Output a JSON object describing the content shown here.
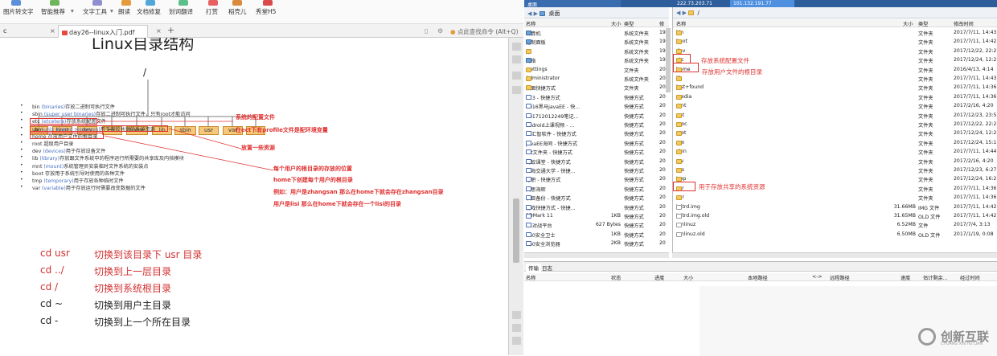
{
  "toolbar": {
    "items": [
      "图片转文字",
      "智能推荐",
      "文字工具",
      "朗读",
      "文档修复",
      "划词翻译",
      "打赏",
      "稻壳儿",
      "秀堂H5"
    ],
    "chevron": "▾"
  },
  "tabs": {
    "first": "c",
    "active": "day26--linux入门.pdf",
    "add": "+",
    "close": "×",
    "search_placeholder": "点此查找命令 (Alt+Q)"
  },
  "doc": {
    "title": "Linux目录结构",
    "root": "/",
    "boxes": [
      "bin",
      "boot",
      "dev",
      "etc",
      "home",
      "lib",
      "sbin",
      "usr",
      "var",
      "..."
    ],
    "bullets": [
      {
        "head": "bin",
        "blue": "(binaries)",
        "rest": "存放二进制可执行文件"
      },
      {
        "head": "sbin",
        "blue": "(super user binaries)",
        "rest": "存放二进制可执行文件，只有root才能访问"
      },
      {
        "head": "etc",
        "blue": "(etcetera)",
        "rest": "存放系统配置文件"
      },
      {
        "head": "usr",
        "blue": "(unix shared resources)",
        "rest": "用于存放共享的系统资源"
      },
      {
        "head": "home",
        "blue": "",
        "rest": "存放用户文件的根目录"
      },
      {
        "head": "root",
        "blue": "",
        "rest": "超级用户目录"
      },
      {
        "head": "dev",
        "blue": "(devices)",
        "rest": "用于存放设备文件"
      },
      {
        "head": "lib",
        "blue": "(library)",
        "rest": "存放跟文件系统中的程序运行所需要的共享库及内核模块"
      },
      {
        "head": "mnt",
        "blue": "(mount)",
        "rest": "系统管理员安装临时文件系统的安装点"
      },
      {
        "head": "boot",
        "blue": "",
        "rest": "存放用于系统引导时使用的各种文件"
      },
      {
        "head": "tmp",
        "blue": "(temporary)",
        "rest": "用于存放各种临时文件"
      },
      {
        "head": "var",
        "blue": "(variable)",
        "rest": "用于存放运行时需要改变数据的文件"
      }
    ],
    "notes": [
      "系统的配置文件",
      "在ect下有profile文件是配环境变量",
      "放置一些资源",
      "每个用户的根目录的存放的位置",
      "home下创建每个用户的根目录",
      "例如：用户是zhangsan 那么在home下就会存在zhangsan目录",
      "用户是lisi 那么在home下就会存在一个lisi的目录"
    ],
    "commands": [
      {
        "cmd": "cd usr",
        "desc": "切换到该目录下 usr 目录",
        "color": "#d23030"
      },
      {
        "cmd": "cd ../",
        "desc": "切换到上一层目录",
        "color": "#d23030"
      },
      {
        "cmd": "cd /",
        "desc": "切换到系统根目录",
        "color": "#d23030"
      },
      {
        "cmd": "cd ~",
        "desc": "切换到用户主目录",
        "color": "#222222"
      },
      {
        "cmd": "cd -",
        "desc": "切换到上一个所在目录",
        "color": "#222222"
      }
    ]
  },
  "ftp": {
    "window_tabs": [
      "桌面",
      "222.73.203.71",
      "101.132.191.77"
    ],
    "local_path": "桌面",
    "remote_path": "/",
    "local_cols": {
      "name": "名称",
      "size": "大小",
      "type": "类型",
      "mod": "修"
    },
    "remote_cols": {
      "name": "名称",
      "size": "大小",
      "type": "类型",
      "mod": "修改时间"
    },
    "local_rows": [
      {
        "name": "计算机",
        "size": "",
        "type": "系统文件夹",
        "mod": "19",
        "icon": "sys"
      },
      {
        "name": "控制面板",
        "size": "",
        "type": "系统文件夹",
        "mod": "19",
        "icon": "sys"
      },
      {
        "name": "库",
        "size": "",
        "type": "系统文件夹",
        "mod": "19",
        "icon": "fld"
      },
      {
        "name": "网络",
        "size": "",
        "type": "系统文件夹",
        "mod": "19",
        "icon": "sys"
      },
      {
        "name": ".settings",
        "size": "",
        "type": "文件夹",
        "mod": "20",
        "icon": "fld"
      },
      {
        "name": "Administrator",
        "size": "",
        "type": "系统文件夹",
        "mod": "20",
        "icon": "fld"
      },
      {
        "name": "桌面快捷方式",
        "size": "",
        "type": "文件夹",
        "mod": "20",
        "icon": "fld"
      },
      {
        "name": "123 - 快捷方式",
        "size": "",
        "type": "快捷方式",
        "mod": "20",
        "icon": "lnk"
      },
      {
        "name": "2016黑马javaEE - 快...",
        "size": "",
        "type": "快捷方式",
        "mod": "20",
        "icon": "lnk"
      },
      {
        "name": "201712012249笔记...",
        "size": "",
        "type": "快捷方式",
        "mod": "20",
        "icon": "lnk"
      },
      {
        "name": "android上课视频 - ...",
        "size": "",
        "type": "快捷方式",
        "mod": "20",
        "icon": "lnk"
      },
      {
        "name": "hz汇智软件 - 快捷方式",
        "size": "",
        "type": "快捷方式",
        "mod": "20",
        "icon": "lnk"
      },
      {
        "name": "JavaEE海同 - 快捷方式",
        "size": "",
        "type": "快捷方式",
        "mod": "20",
        "icon": "lnk"
      },
      {
        "name": "txt文件夹 - 快捷方式",
        "size": "",
        "type": "快捷方式",
        "mod": "20",
        "icon": "lnk"
      },
      {
        "name": "蚂蚁课堂 - 快捷方式",
        "size": "",
        "type": "快捷方式",
        "mod": "20",
        "icon": "lnk"
      },
      {
        "name": "上海交通大学 - 快捷...",
        "size": "",
        "type": "快捷方式",
        "mod": "20",
        "icon": "lnk"
      },
      {
        "name": "万职 - 快捷方式",
        "size": "",
        "type": "快捷方式",
        "mod": "20",
        "icon": "lnk"
      },
      {
        "name": "文思海辉",
        "size": "",
        "type": "快捷方式",
        "mod": "20",
        "icon": "lnk"
      },
      {
        "name": "项目备份 - 快捷方式",
        "size": "",
        "type": "快捷方式",
        "mod": "20",
        "icon": "lnk"
      },
      {
        "name": "游戏快捷方式 - 快捷...",
        "size": "",
        "type": "快捷方式",
        "mod": "20",
        "icon": "lnk"
      },
      {
        "name": "3DMark 11",
        "size": "1KB",
        "type": "快捷方式",
        "mod": "20",
        "icon": "lnk"
      },
      {
        "name": "11对战平台",
        "size": "627 Bytes",
        "type": "快捷方式",
        "mod": "20",
        "icon": "lnk"
      },
      {
        "name": "360安全卫士",
        "size": "1KB",
        "type": "快捷方式",
        "mod": "20",
        "icon": "lnk"
      },
      {
        "name": "360安全浏览器",
        "size": "2KB",
        "type": "快捷方式",
        "mod": "20",
        "icon": "lnk"
      }
    ],
    "remote_rows": [
      {
        "name": "bin",
        "size": "",
        "type": "文件夹",
        "mod": "2017/7/11, 14:43",
        "icon": "fld"
      },
      {
        "name": "boot",
        "size": "",
        "type": "文件夹",
        "mod": "2017/7/11, 14:42",
        "icon": "fld"
      },
      {
        "name": "dev",
        "size": "",
        "type": "文件夹",
        "mod": "2017/12/22, 22:27",
        "icon": "fld"
      },
      {
        "name": "etc",
        "size": "",
        "type": "文件夹",
        "mod": "2017/12/24, 12:20",
        "icon": "fld"
      },
      {
        "name": "home",
        "size": "",
        "type": "文件夹",
        "mod": "2016/4/13, 4:14",
        "icon": "fld"
      },
      {
        "name": "lib",
        "size": "",
        "type": "文件夹",
        "mod": "2017/7/11, 14:43",
        "icon": "fld"
      },
      {
        "name": "lost+found",
        "size": "",
        "type": "文件夹",
        "mod": "2017/7/11, 14:36",
        "icon": "fld"
      },
      {
        "name": "media",
        "size": "",
        "type": "文件夹",
        "mod": "2017/7/11, 14:36",
        "icon": "fld"
      },
      {
        "name": "mnt",
        "size": "",
        "type": "文件夹",
        "mod": "2017/2/16, 4:20",
        "icon": "fld"
      },
      {
        "name": "opt",
        "size": "",
        "type": "文件夹",
        "mod": "2017/12/23, 23:51",
        "icon": "fld"
      },
      {
        "name": "proc",
        "size": "",
        "type": "文件夹",
        "mod": "2017/12/22, 22:27",
        "icon": "fld"
      },
      {
        "name": "root",
        "size": "",
        "type": "文件夹",
        "mod": "2017/12/24, 12:20",
        "icon": "fld"
      },
      {
        "name": "run",
        "size": "",
        "type": "文件夹",
        "mod": "2017/12/24, 15:10",
        "icon": "fld"
      },
      {
        "name": "sbin",
        "size": "",
        "type": "文件夹",
        "mod": "2017/7/11, 14:44",
        "icon": "fld"
      },
      {
        "name": "srv",
        "size": "",
        "type": "文件夹",
        "mod": "2017/2/16, 4:20",
        "icon": "fld"
      },
      {
        "name": "sys",
        "size": "",
        "type": "文件夹",
        "mod": "2017/12/23, 6:27",
        "icon": "fld"
      },
      {
        "name": "tmp",
        "size": "",
        "type": "文件夹",
        "mod": "2017/12/24, 16:25",
        "icon": "fld"
      },
      {
        "name": "usr",
        "size": "",
        "type": "文件夹",
        "mod": "2017/7/11, 14:36",
        "icon": "fld"
      },
      {
        "name": "var",
        "size": "",
        "type": "文件夹",
        "mod": "2017/7/11, 14:36",
        "icon": "fld"
      },
      {
        "name": "initrd.img",
        "size": "31.66MB",
        "type": "IMG 文件",
        "mod": "2017/7/11, 14:42",
        "icon": "file"
      },
      {
        "name": "initrd.img.old",
        "size": "31.65MB",
        "type": "OLD 文件",
        "mod": "2017/7/11, 14:42",
        "icon": "file"
      },
      {
        "name": "vmlinuz",
        "size": "6.52MB",
        "type": "文件",
        "mod": "2017/7/4, 3:13",
        "icon": "file"
      },
      {
        "name": "vmlinuz.old",
        "size": "6.50MB",
        "type": "OLD 文件",
        "mod": "2017/1/19, 0:08",
        "icon": "file"
      }
    ],
    "remote_notes": [
      "存放系统配置文件",
      "存放用户文件的根目录",
      "用于存放共享的系统资源"
    ],
    "transfer_tabs": [
      "传输",
      "日志"
    ],
    "transfer_cols": [
      "名称",
      "状态",
      "进度",
      "大小",
      "本地路径",
      "<->",
      "远程路径",
      "速度",
      "估计剩余...",
      "经过时间"
    ]
  },
  "watermark": {
    "brand": "创新互联",
    "sub": "CHUANG XIN HU LIAN"
  }
}
